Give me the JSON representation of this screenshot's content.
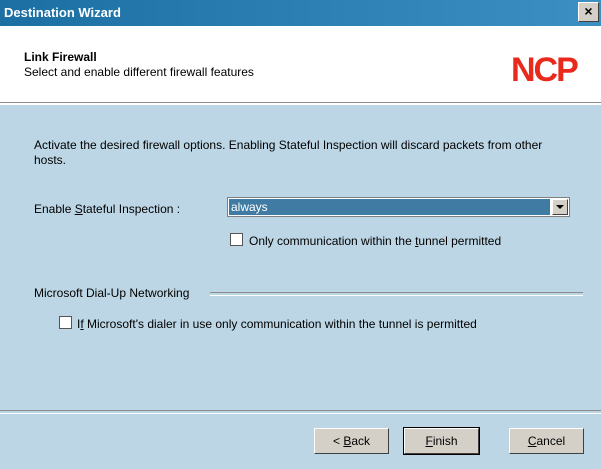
{
  "window": {
    "title": "Destination Wizard",
    "close_label": "×"
  },
  "header": {
    "title": "Link Firewall",
    "subtitle": "Select and enable different firewall features",
    "logo_text": "NCP",
    "logo_color": "#e8291c"
  },
  "main": {
    "intro": "Activate the desired firewall options. Enabling Stateful Inspection will discard packets from other hosts.",
    "stateful": {
      "label_pre": "Enable ",
      "label_key": "S",
      "label_post": "tateful Inspection :",
      "value": "always"
    },
    "tunnel_checkbox": {
      "label_pre": "Only communication within the ",
      "label_key": "t",
      "label_post": "unnel permitted",
      "checked": false
    },
    "dialup_group": {
      "label": "Microsoft Dial-Up Networking",
      "checkbox": {
        "label_pre": "I",
        "label_key": "f",
        "label_post": " Microsoft's dialer in use only communication within the tunnel is permitted",
        "checked": false
      }
    }
  },
  "buttons": {
    "back": {
      "pre": "< ",
      "key": "B",
      "post": "ack"
    },
    "finish": {
      "pre": "",
      "key": "F",
      "post": "inish"
    },
    "cancel": {
      "pre": "",
      "key": "C",
      "post": "ancel"
    }
  },
  "colors": {
    "titlebar": "#2a7fb4",
    "body_bg": "#bcd6e5",
    "selection": "#3f7ba3"
  }
}
